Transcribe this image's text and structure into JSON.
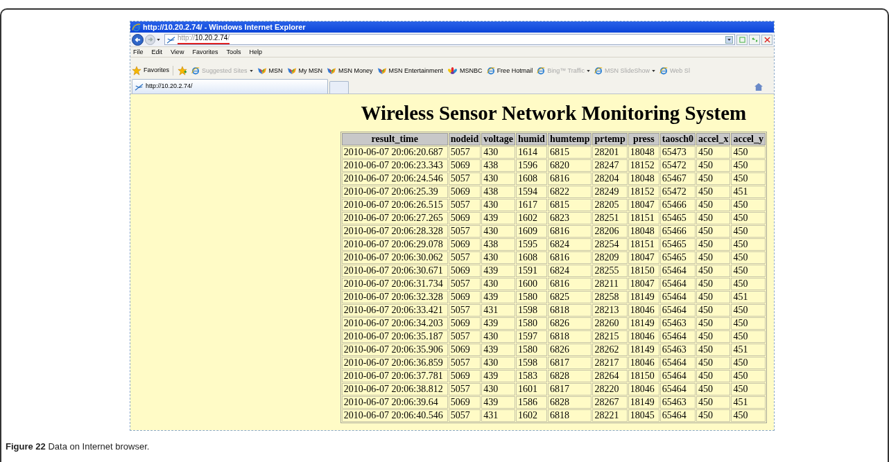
{
  "window": {
    "title": "http://10.20.2.74/ - Windows Internet Explorer"
  },
  "address": {
    "scheme": "http://",
    "host": "10.20.2.74",
    "path": "/",
    "underlined": true
  },
  "menu": [
    "File",
    "Edit",
    "View",
    "Favorites",
    "Tools",
    "Help"
  ],
  "favorites_bar": {
    "label": "Favorites",
    "items": [
      {
        "kind": "ie",
        "label": "Suggested Sites",
        "disabled": true,
        "dropdown": true
      },
      {
        "kind": "msn",
        "label": "MSN",
        "disabled": false,
        "dropdown": false
      },
      {
        "kind": "msn",
        "label": "My MSN",
        "disabled": false,
        "dropdown": false
      },
      {
        "kind": "msn",
        "label": "MSN Money",
        "disabled": false,
        "dropdown": false
      },
      {
        "kind": "msn",
        "label": "MSN Entertainment",
        "disabled": false,
        "dropdown": false
      },
      {
        "kind": "msnbc",
        "label": "MSNBC",
        "disabled": false,
        "dropdown": false
      },
      {
        "kind": "ie",
        "label": "Free Hotmail",
        "disabled": false,
        "dropdown": false
      },
      {
        "kind": "ie",
        "label": "Bing™ Traffic",
        "disabled": true,
        "dropdown": true
      },
      {
        "kind": "ie",
        "label": "MSN SlideShow",
        "disabled": true,
        "dropdown": true
      },
      {
        "kind": "ie",
        "label": "Web Sl",
        "disabled": true,
        "dropdown": false
      }
    ]
  },
  "tabs": [
    {
      "label": "http://10.20.2.74/",
      "selected": true
    }
  ],
  "page": {
    "heading": "Wireless Sensor Network Monitoring System",
    "table": {
      "columns": [
        "result_time",
        "nodeid",
        "voltage",
        "humid",
        "humtemp",
        "prtemp",
        "press",
        "taosch0",
        "accel_x",
        "accel_y"
      ],
      "rows": [
        [
          "2010-06-07 20:06:20.687",
          "5057",
          "430",
          "1614",
          "6815",
          "28201",
          "18048",
          "65473",
          "450",
          "450"
        ],
        [
          "2010-06-07 20:06:23.343",
          "5069",
          "438",
          "1596",
          "6820",
          "28247",
          "18152",
          "65472",
          "450",
          "450"
        ],
        [
          "2010-06-07 20:06:24.546",
          "5057",
          "430",
          "1608",
          "6816",
          "28204",
          "18048",
          "65467",
          "450",
          "450"
        ],
        [
          "2010-06-07 20:06:25.39",
          "5069",
          "438",
          "1594",
          "6822",
          "28249",
          "18152",
          "65472",
          "450",
          "451"
        ],
        [
          "2010-06-07 20:06:26.515",
          "5057",
          "430",
          "1617",
          "6815",
          "28205",
          "18047",
          "65466",
          "450",
          "450"
        ],
        [
          "2010-06-07 20:06:27.265",
          "5069",
          "439",
          "1602",
          "6823",
          "28251",
          "18151",
          "65465",
          "450",
          "450"
        ],
        [
          "2010-06-07 20:06:28.328",
          "5057",
          "430",
          "1609",
          "6816",
          "28206",
          "18048",
          "65466",
          "450",
          "450"
        ],
        [
          "2010-06-07 20:06:29.078",
          "5069",
          "438",
          "1595",
          "6824",
          "28254",
          "18151",
          "65465",
          "450",
          "450"
        ],
        [
          "2010-06-07 20:06:30.062",
          "5057",
          "430",
          "1608",
          "6816",
          "28209",
          "18047",
          "65465",
          "450",
          "450"
        ],
        [
          "2010-06-07 20:06:30.671",
          "5069",
          "439",
          "1591",
          "6824",
          "28255",
          "18150",
          "65464",
          "450",
          "450"
        ],
        [
          "2010-06-07 20:06:31.734",
          "5057",
          "430",
          "1600",
          "6816",
          "28211",
          "18047",
          "65464",
          "450",
          "450"
        ],
        [
          "2010-06-07 20:06:32.328",
          "5069",
          "439",
          "1580",
          "6825",
          "28258",
          "18149",
          "65464",
          "450",
          "451"
        ],
        [
          "2010-06-07 20:06:33.421",
          "5057",
          "431",
          "1598",
          "6818",
          "28213",
          "18046",
          "65464",
          "450",
          "450"
        ],
        [
          "2010-06-07 20:06:34.203",
          "5069",
          "439",
          "1580",
          "6826",
          "28260",
          "18149",
          "65463",
          "450",
          "450"
        ],
        [
          "2010-06-07 20:06:35.187",
          "5057",
          "430",
          "1597",
          "6818",
          "28215",
          "18046",
          "65464",
          "450",
          "450"
        ],
        [
          "2010-06-07 20:06:35.906",
          "5069",
          "439",
          "1580",
          "6826",
          "28262",
          "18149",
          "65463",
          "450",
          "451"
        ],
        [
          "2010-06-07 20:06:36.859",
          "5057",
          "430",
          "1598",
          "6817",
          "28217",
          "18046",
          "65464",
          "450",
          "450"
        ],
        [
          "2010-06-07 20:06:37.781",
          "5069",
          "439",
          "1583",
          "6828",
          "28264",
          "18150",
          "65464",
          "450",
          "450"
        ],
        [
          "2010-06-07 20:06:38.812",
          "5057",
          "430",
          "1601",
          "6817",
          "28220",
          "18046",
          "65464",
          "450",
          "450"
        ],
        [
          "2010-06-07 20:06:39.64",
          "5069",
          "439",
          "1586",
          "6828",
          "28267",
          "18149",
          "65463",
          "450",
          "451"
        ],
        [
          "2010-06-07 20:06:40.546",
          "5057",
          "431",
          "1602",
          "6818",
          "28221",
          "18045",
          "65464",
          "450",
          "450"
        ]
      ]
    }
  },
  "caption": "**Figure 22** Data on Internet browser."
}
